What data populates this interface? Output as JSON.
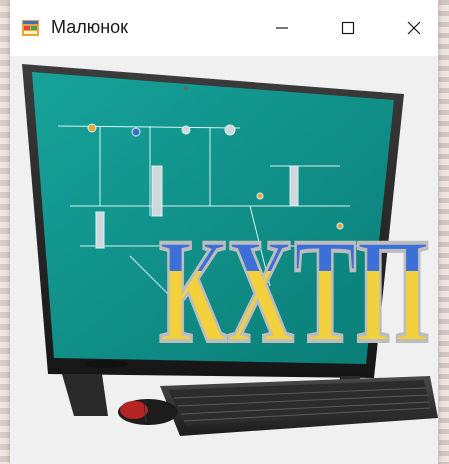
{
  "window": {
    "title": "Малюнок",
    "app_icon": "form-icon",
    "controls": {
      "minimize": "minimize-icon",
      "maximize": "maximize-icon",
      "close": "close-icon"
    }
  },
  "image": {
    "subject": "computer-monitor-with-keyboard-and-mouse",
    "logo_text": "КХТП",
    "logo_colors": {
      "top": "#3c6fd8",
      "bottom": "#f2d13c",
      "outline": "#bdbdbd"
    },
    "screen_color": "#0f8f88"
  }
}
